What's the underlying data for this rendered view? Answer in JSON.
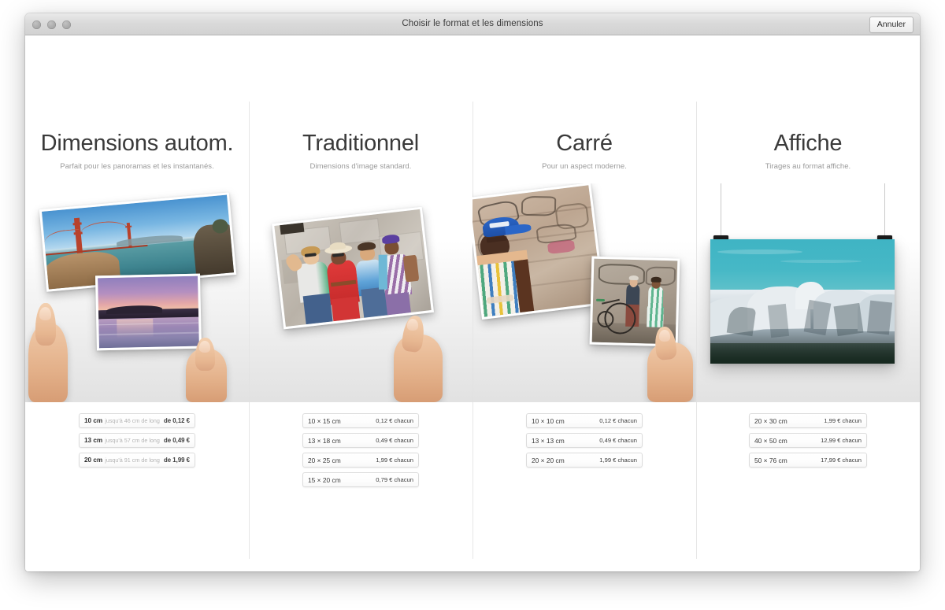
{
  "window": {
    "title": "Choisir le format et les dimensions",
    "cancel_label": "Annuler",
    "traffic_lights": [
      "close-button",
      "minimize-button",
      "zoom-button"
    ]
  },
  "columns": [
    {
      "id": "dimensions-auto",
      "title": "Dimensions autom.",
      "subtitle": "Parfait pour les panoramas et les instantanés.",
      "artwork": "two-panorama-prints-held-in-hands",
      "options": [
        {
          "size": "10 cm",
          "note": "jusqu'à 46 cm de long",
          "price": "de 0,12 €"
        },
        {
          "size": "13 cm",
          "note": "jusqu'à 57 cm de long",
          "price": "de 0,49 €"
        },
        {
          "size": "20 cm",
          "note": "jusqu'à 91 cm de long",
          "price": "de 1,99 €"
        }
      ]
    },
    {
      "id": "traditionnel",
      "title": "Traditionnel",
      "subtitle": "Dimensions d'image standard.",
      "artwork": "group-of-friends-photo-held-in-hand",
      "options": [
        {
          "size": "10 × 15 cm",
          "note": "",
          "price": "0,12 € chacun"
        },
        {
          "size": "13 × 18 cm",
          "note": "",
          "price": "0,49 € chacun"
        },
        {
          "size": "20 × 25 cm",
          "note": "",
          "price": "1,99 € chacun"
        },
        {
          "size": "15 × 20 cm",
          "note": "",
          "price": "0,79 € chacun"
        }
      ]
    },
    {
      "id": "carre",
      "title": "Carré",
      "subtitle": "Pour un aspect moderne.",
      "artwork": "two-square-street-photos-held-in-hand",
      "options": [
        {
          "size": "10 × 10 cm",
          "note": "",
          "price": "0,12 € chacun"
        },
        {
          "size": "13 × 13 cm",
          "note": "",
          "price": "0,49 € chacun"
        },
        {
          "size": "20 × 20 cm",
          "note": "",
          "price": "1,99 € chacun"
        }
      ]
    },
    {
      "id": "affiche",
      "title": "Affiche",
      "subtitle": "Tirages au format affiche.",
      "artwork": "mountain-poster-hanging-from-clips",
      "options": [
        {
          "size": "20 × 30 cm",
          "note": "",
          "price": "1,99 € chacun"
        },
        {
          "size": "40 × 50 cm",
          "note": "",
          "price": "12,99 € chacun"
        },
        {
          "size": "50 × 76 cm",
          "note": "",
          "price": "17,99 € chacun"
        }
      ]
    }
  ],
  "colors": {
    "titlebar": "#d9d9d9",
    "divider": "#e6e6e6",
    "text_primary": "#3a3a3a",
    "text_muted": "#9a9a9a"
  }
}
